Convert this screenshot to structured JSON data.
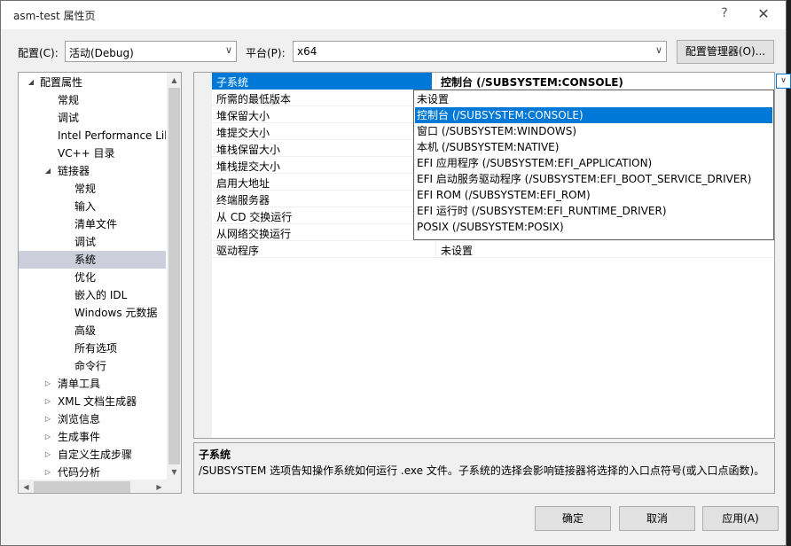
{
  "window": {
    "title": "asm-test 属性页",
    "help": "?",
    "close": "✕"
  },
  "config": {
    "config_label": "配置(C):",
    "config_value": "活动(Debug)",
    "platform_label": "平台(P):",
    "platform_value": "x64",
    "manager_button": "配置管理器(O)..."
  },
  "tree": [
    {
      "label": "配置属性",
      "level": 0,
      "expander": "◢"
    },
    {
      "label": "常规",
      "level": 2
    },
    {
      "label": "调试",
      "level": 2
    },
    {
      "label": "Intel Performance Lib",
      "level": 2
    },
    {
      "label": "VC++ 目录",
      "level": 2
    },
    {
      "label": "链接器",
      "level": 1,
      "expander": "◢"
    },
    {
      "label": "常规",
      "level": 3
    },
    {
      "label": "输入",
      "level": 3
    },
    {
      "label": "清单文件",
      "level": 3
    },
    {
      "label": "调试",
      "level": 3
    },
    {
      "label": "系统",
      "level": 3,
      "selected": true
    },
    {
      "label": "优化",
      "level": 3
    },
    {
      "label": "嵌入的 IDL",
      "level": 3
    },
    {
      "label": "Windows 元数据",
      "level": 3
    },
    {
      "label": "高级",
      "level": 3
    },
    {
      "label": "所有选项",
      "level": 3
    },
    {
      "label": "命令行",
      "level": 3
    },
    {
      "label": "清单工具",
      "level": 1,
      "expander": "▷"
    },
    {
      "label": "XML 文档生成器",
      "level": 1,
      "expander": "▷"
    },
    {
      "label": "浏览信息",
      "level": 1,
      "expander": "▷"
    },
    {
      "label": "生成事件",
      "level": 1,
      "expander": "▷"
    },
    {
      "label": "自定义生成步骤",
      "level": 1,
      "expander": "▷"
    },
    {
      "label": "代码分析",
      "level": 1,
      "expander": "▷"
    }
  ],
  "scroll_arrows": {
    "up": "▲",
    "down": "▼",
    "left": "◀",
    "right": "▶"
  },
  "properties": [
    {
      "name": "子系统",
      "value": "控制台 (/SUBSYSTEM:CONSOLE)",
      "selected": true
    },
    {
      "name": "所需的最低版本",
      "value": ""
    },
    {
      "name": "堆保留大小",
      "value": ""
    },
    {
      "name": "堆提交大小",
      "value": ""
    },
    {
      "name": "堆栈保留大小",
      "value": ""
    },
    {
      "name": "堆栈提交大小",
      "value": ""
    },
    {
      "name": "启用大地址",
      "value": ""
    },
    {
      "name": "终端服务器",
      "value": ""
    },
    {
      "name": "从 CD 交换运行",
      "value": ""
    },
    {
      "name": "从网络交换运行",
      "value": ""
    },
    {
      "name": "驱动程序",
      "value": "未设置"
    }
  ],
  "dropdown_arrow": "∨",
  "dropdown_options": [
    {
      "label": "未设置"
    },
    {
      "label": "控制台 (/SUBSYSTEM:CONSOLE)",
      "highlighted": true
    },
    {
      "label": "窗口 (/SUBSYSTEM:WINDOWS)"
    },
    {
      "label": "本机 (/SUBSYSTEM:NATIVE)"
    },
    {
      "label": "EFI 应用程序 (/SUBSYSTEM:EFI_APPLICATION)"
    },
    {
      "label": "EFI 启动服务驱动程序 (/SUBSYSTEM:EFI_BOOT_SERVICE_DRIVER)"
    },
    {
      "label": "EFI ROM (/SUBSYSTEM:EFI_ROM)"
    },
    {
      "label": "EFI 运行时 (/SUBSYSTEM:EFI_RUNTIME_DRIVER)"
    },
    {
      "label": "POSIX (/SUBSYSTEM:POSIX)"
    }
  ],
  "description": {
    "title": "子系统",
    "body": "/SUBSYSTEM 选项告知操作系统如何运行 .exe 文件。子系统的选择会影响链接器将选择的入口点符号(或入口点函数)。"
  },
  "buttons": {
    "ok": "确定",
    "cancel": "取消",
    "apply": "应用(A)"
  },
  "colors": {
    "accent": "#0078d7",
    "tree_selected": "#cccedb"
  }
}
